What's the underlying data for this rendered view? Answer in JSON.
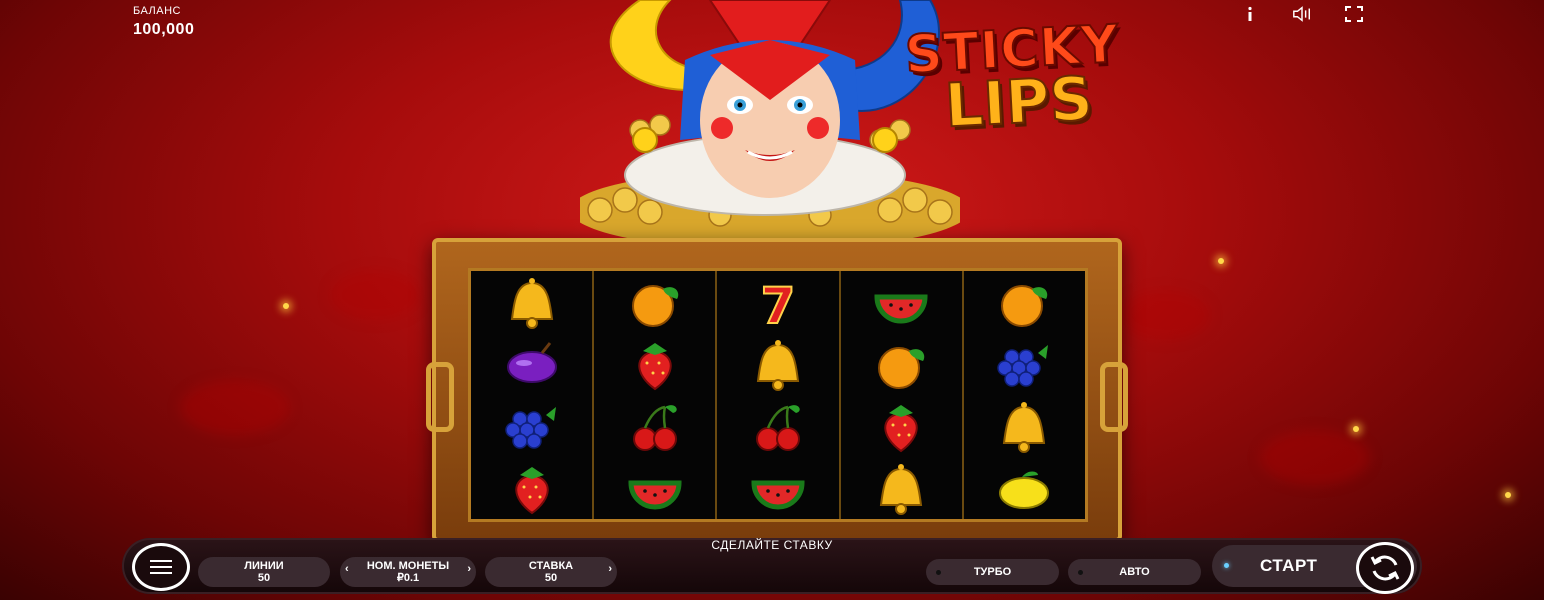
{
  "header": {
    "balance_label": "БАЛАНС",
    "balance_value": "100,000",
    "icons": [
      "info-icon",
      "sound-icon",
      "fullscreen-icon"
    ]
  },
  "logo": {
    "line1": "STICKY",
    "line2": "LIPS"
  },
  "reels": [
    [
      "bell",
      "plum",
      "grapes",
      "strawberry"
    ],
    [
      "orange",
      "strawberry",
      "cherries",
      "watermelon"
    ],
    [
      "seven",
      "bell",
      "cherries",
      "watermelon"
    ],
    [
      "watermelon",
      "orange",
      "strawberry",
      "bell"
    ],
    [
      "orange",
      "grapes",
      "bell",
      "lemon"
    ]
  ],
  "controls": {
    "prompt": "СДЕЛАЙТЕ СТАВКУ",
    "lines_label": "ЛИНИИ",
    "lines_value": "50",
    "coin_label": "НОМ. МОНЕТЫ",
    "coin_value": "₽0.1",
    "bet_label": "СТАВКА",
    "bet_value": "50",
    "turbo_label": "ТУРБО",
    "auto_label": "АВТО",
    "start_label": "СТАРТ"
  },
  "colors": {
    "accent": "#d7a23a",
    "background": "#a60c0c",
    "bar": "#2b1418"
  }
}
